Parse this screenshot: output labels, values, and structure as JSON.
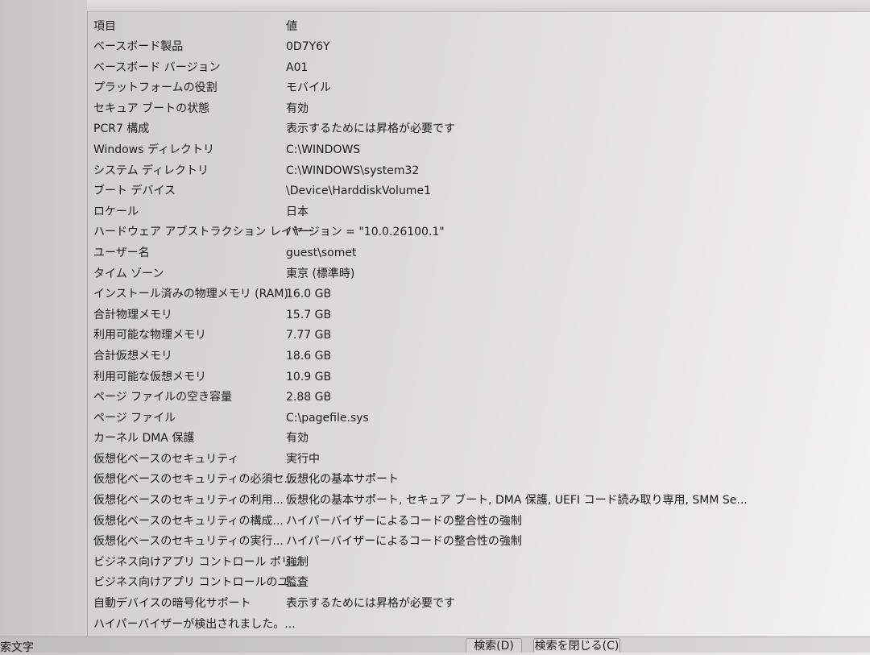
{
  "header": {
    "item": "項目",
    "value": "値"
  },
  "rows": [
    {
      "item": "ベースボード製品",
      "value": "0D7Y6Y"
    },
    {
      "item": "ベースボード バージョン",
      "value": "A01"
    },
    {
      "item": "プラットフォームの役割",
      "value": "モバイル"
    },
    {
      "item": "セキュア ブートの状態",
      "value": "有効"
    },
    {
      "item": "PCR7 構成",
      "value": "表示するためには昇格が必要です"
    },
    {
      "item": "Windows ディレクトリ",
      "value": "C:\\WINDOWS"
    },
    {
      "item": "システム ディレクトリ",
      "value": "C:\\WINDOWS\\system32"
    },
    {
      "item": "ブート デバイス",
      "value": "\\Device\\HarddiskVolume1"
    },
    {
      "item": "ロケール",
      "value": "日本"
    },
    {
      "item": "ハードウェア アブストラクション レイヤー",
      "value": "バージョン = \"10.0.26100.1\""
    },
    {
      "item": "ユーザー名",
      "value": "guest\\somet"
    },
    {
      "item": "タイム ゾーン",
      "value": "東京 (標準時)"
    },
    {
      "item": "インストール済みの物理メモリ (RAM)",
      "value": "16.0 GB"
    },
    {
      "item": "合計物理メモリ",
      "value": "15.7 GB"
    },
    {
      "item": "利用可能な物理メモリ",
      "value": "7.77 GB"
    },
    {
      "item": "合計仮想メモリ",
      "value": "18.6 GB"
    },
    {
      "item": "利用可能な仮想メモリ",
      "value": "10.9 GB"
    },
    {
      "item": "ページ ファイルの空き容量",
      "value": "2.88 GB"
    },
    {
      "item": "ページ ファイル",
      "value": "C:\\pagefile.sys"
    },
    {
      "item": "カーネル DMA 保護",
      "value": "有効"
    },
    {
      "item": "仮想化ベースのセキュリティ",
      "value": "実行中"
    },
    {
      "item": "仮想化ベースのセキュリティの必須セ...",
      "value": "仮想化の基本サポート"
    },
    {
      "item": "仮想化ベースのセキュリティの利用...",
      "value": "仮想化の基本サポート, セキュア ブート, DMA 保護, UEFI コード読み取り専用, SMM Se..."
    },
    {
      "item": "仮想化ベースのセキュリティの構成...",
      "value": "ハイパーバイザーによるコードの整合性の強制"
    },
    {
      "item": "仮想化ベースのセキュリティの実行...",
      "value": "ハイパーバイザーによるコードの整合性の強制"
    },
    {
      "item": "ビジネス向けアプリ コントロール ポリ...",
      "value": "強制"
    },
    {
      "item": "ビジネス向けアプリ コントロールのユ...",
      "value": "監査"
    },
    {
      "item": "自動デバイスの暗号化サポート",
      "value": "表示するためには昇格が必要です"
    },
    {
      "item": "ハイパーバイザーが検出されました。...",
      "value": ""
    }
  ],
  "footer": {
    "find_label": "索文字",
    "search_button": "検索(D)",
    "close_search_button": "検索を閉じる(C)"
  }
}
